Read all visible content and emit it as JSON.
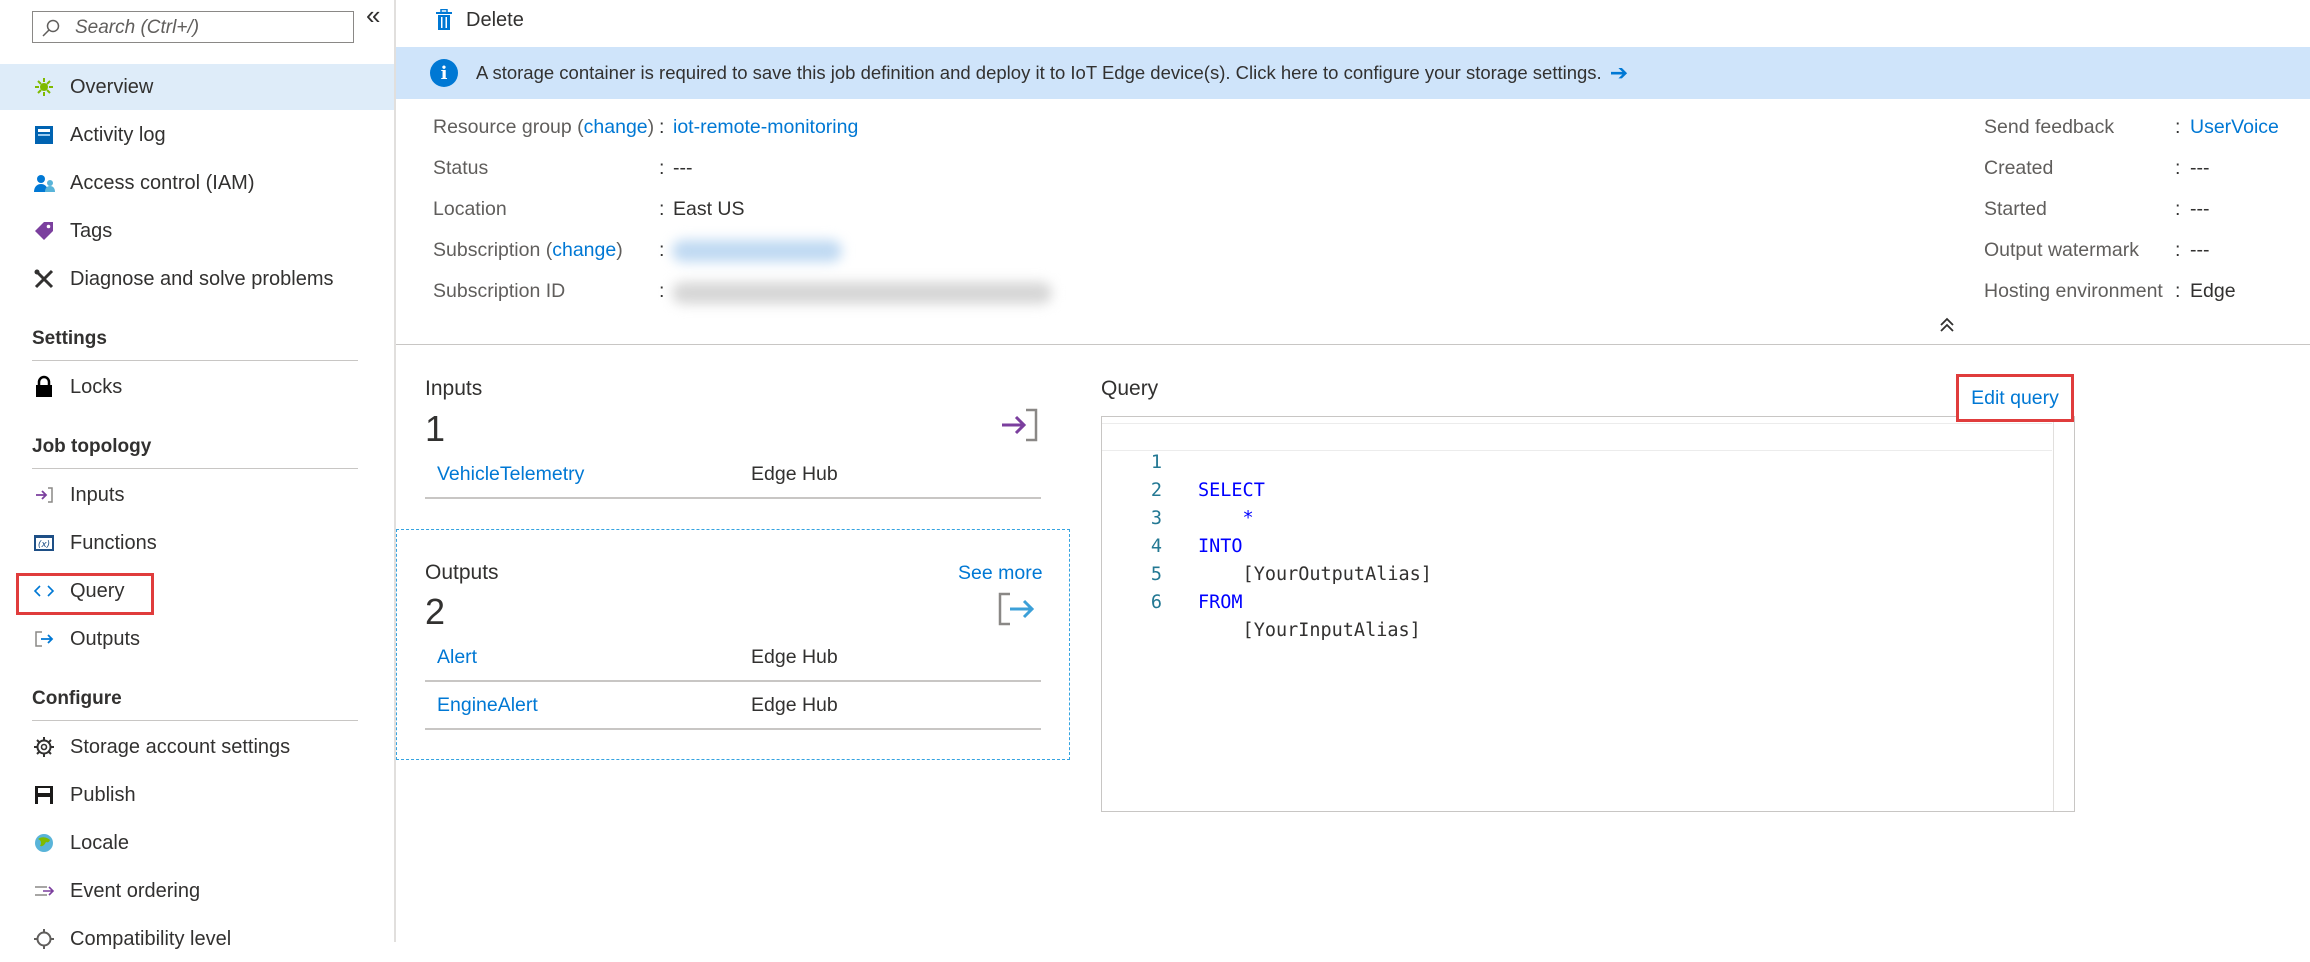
{
  "sidebar": {
    "search_placeholder": "Search (Ctrl+/)",
    "collapse_glyph": "«",
    "items_top": [
      {
        "label": "Overview",
        "icon": "overview-icon"
      },
      {
        "label": "Activity log",
        "icon": "activity-log-icon"
      },
      {
        "label": "Access control (IAM)",
        "icon": "access-control-icon"
      },
      {
        "label": "Tags",
        "icon": "tag-icon"
      },
      {
        "label": "Diagnose and solve problems",
        "icon": "wrench-icon"
      }
    ],
    "settings_title": "Settings",
    "settings_items": [
      {
        "label": "Locks",
        "icon": "lock-icon"
      }
    ],
    "job_topology_title": "Job topology",
    "job_topology_items": [
      {
        "label": "Inputs",
        "icon": "inputs-icon"
      },
      {
        "label": "Functions",
        "icon": "functions-icon"
      },
      {
        "label": "Query",
        "icon": "code-icon"
      },
      {
        "label": "Outputs",
        "icon": "outputs-icon"
      }
    ],
    "configure_title": "Configure",
    "configure_items": [
      {
        "label": "Storage account settings",
        "icon": "gear-icon"
      },
      {
        "label": "Publish",
        "icon": "publish-icon"
      },
      {
        "label": "Locale",
        "icon": "globe-icon"
      },
      {
        "label": "Event ordering",
        "icon": "event-ordering-icon"
      },
      {
        "label": "Compatibility level",
        "icon": "gear-icon"
      }
    ]
  },
  "toolbar": {
    "delete_label": "Delete"
  },
  "banner": {
    "info_glyph": "i",
    "message": "A storage container is required to save this job definition and deploy it to IoT Edge device(s). Click here to configure your storage settings.",
    "arrow": "➔"
  },
  "essentials": {
    "colon": ":",
    "left": {
      "resource_group_label": "Resource group",
      "change_label": "change",
      "resource_group_value": "iot-remote-monitoring",
      "status_label": "Status",
      "status_value": "---",
      "location_label": "Location",
      "location_value": "East US",
      "subscription_label": "Subscription",
      "subscription_change_label": "change",
      "subscription_id_label": "Subscription ID"
    },
    "right": {
      "send_feedback_label": "Send feedback",
      "send_feedback_value": "UserVoice",
      "created_label": "Created",
      "created_value": "---",
      "started_label": "Started",
      "started_value": "---",
      "output_watermark_label": "Output watermark",
      "output_watermark_value": "---",
      "hosting_environment_label": "Hosting environment",
      "hosting_environment_value": "Edge"
    }
  },
  "inputs_tile": {
    "title": "Inputs",
    "count": "1",
    "rows": [
      {
        "name": "VehicleTelemetry",
        "type": "Edge Hub"
      }
    ]
  },
  "outputs_tile": {
    "title": "Outputs",
    "count": "2",
    "see_more": "See more",
    "rows": [
      {
        "name": "Alert",
        "type": "Edge Hub"
      },
      {
        "name": "EngineAlert",
        "type": "Edge Hub"
      }
    ]
  },
  "query_tile": {
    "title": "Query",
    "edit_label": "Edit query",
    "lines": [
      {
        "num": "1",
        "text": "SELECT",
        "kind": "kw"
      },
      {
        "num": "2",
        "text": "    *",
        "kind": "kw"
      },
      {
        "num": "3",
        "text": "INTO",
        "kind": "kw"
      },
      {
        "num": "4",
        "text": "    [YourOutputAlias]",
        "kind": "plain"
      },
      {
        "num": "5",
        "text": "FROM",
        "kind": "kw"
      },
      {
        "num": "6",
        "text": "    [YourInputAlias]",
        "kind": "plain"
      }
    ]
  },
  "colors": {
    "accent": "#0078d4",
    "banner_bg": "#cfe4fa",
    "active_nav_bg": "#deecf9",
    "highlight_red": "#e03c3c",
    "keyword_blue": "#0000ff",
    "line_number": "#237893"
  }
}
